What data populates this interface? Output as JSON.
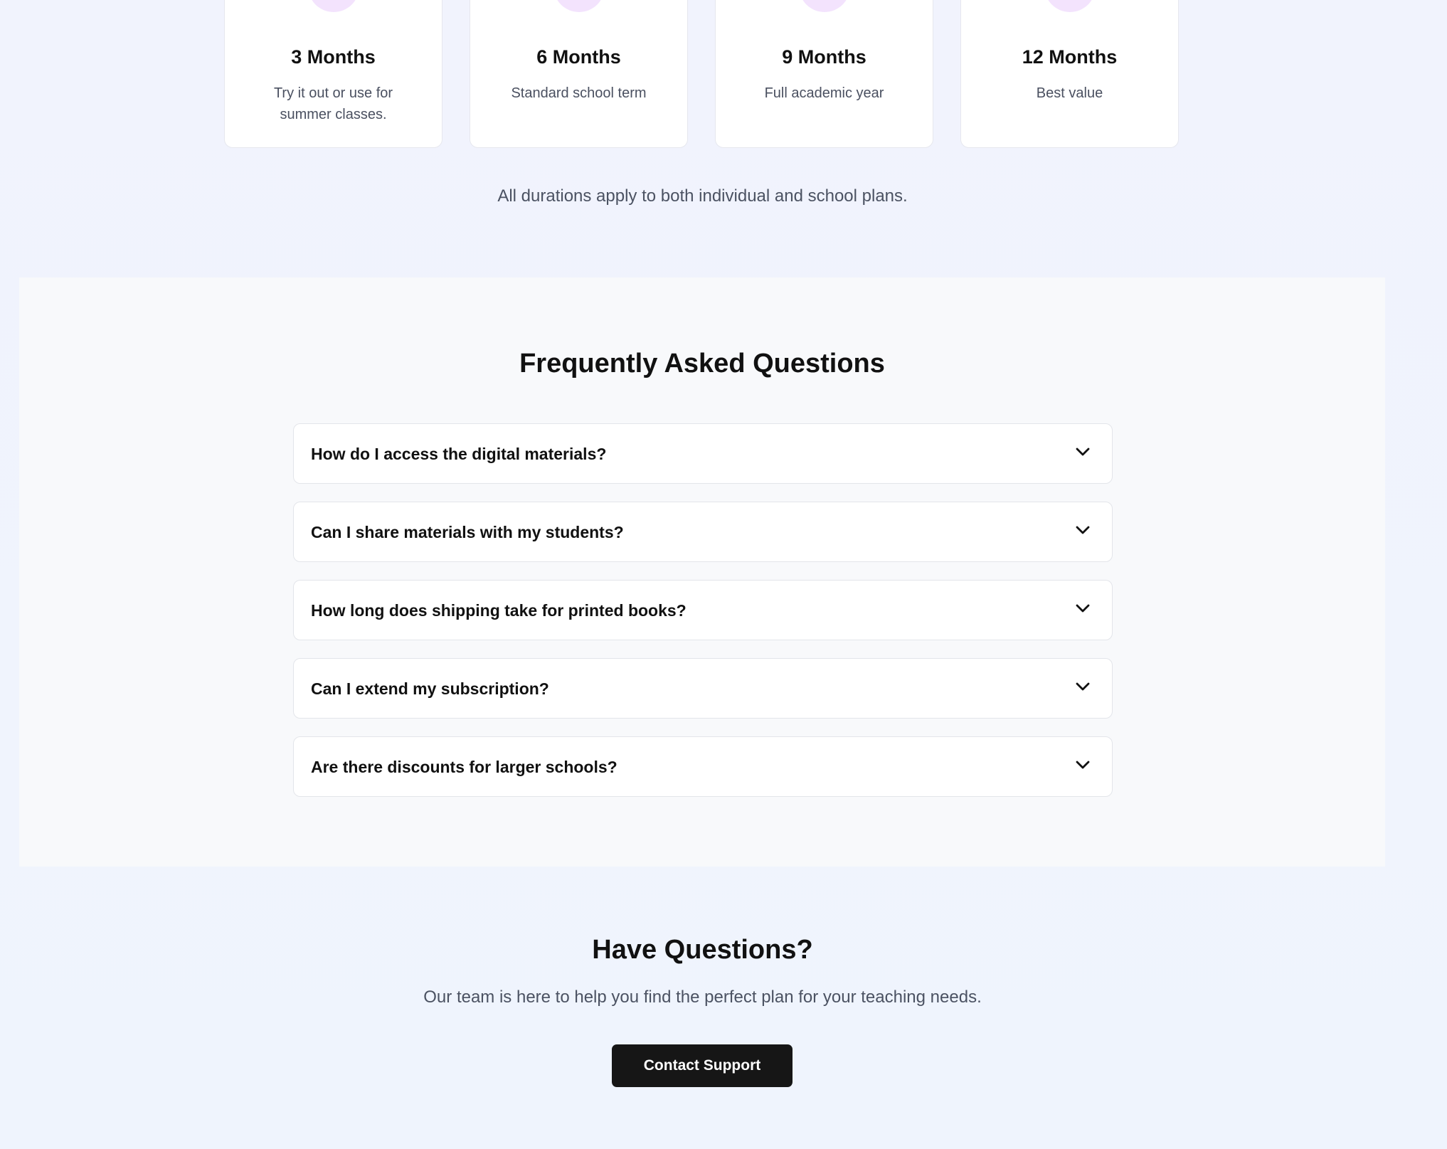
{
  "durations": [
    {
      "title": "3 Months",
      "desc": "Try it out or use for summer classes.",
      "icon": "calendar-icon"
    },
    {
      "title": "6 Months",
      "desc": "Standard school term",
      "icon": "calendar-icon"
    },
    {
      "title": "9 Months",
      "desc": "Full academic year",
      "icon": "calendar-days-icon"
    },
    {
      "title": "12 Months",
      "desc": "Best value",
      "icon": "calendar-check-icon"
    }
  ],
  "durations_note": "All durations apply to both individual and school plans.",
  "faq": {
    "title": "Frequently Asked Questions",
    "items": [
      {
        "question": "How do I access the digital materials?"
      },
      {
        "question": "Can I share materials with my students?"
      },
      {
        "question": "How long does shipping take for printed books?"
      },
      {
        "question": "Can I extend my subscription?"
      },
      {
        "question": "Are there discounts for larger schools?"
      }
    ]
  },
  "cta": {
    "title": "Have Questions?",
    "subtitle": "Our team is here to help you find the perfect plan for your teaching needs.",
    "button_label": "Contact Support"
  },
  "colors": {
    "accent_purple": "#9333ea",
    "icon_bg": "#f3e3fd",
    "button_bg": "#161616"
  }
}
